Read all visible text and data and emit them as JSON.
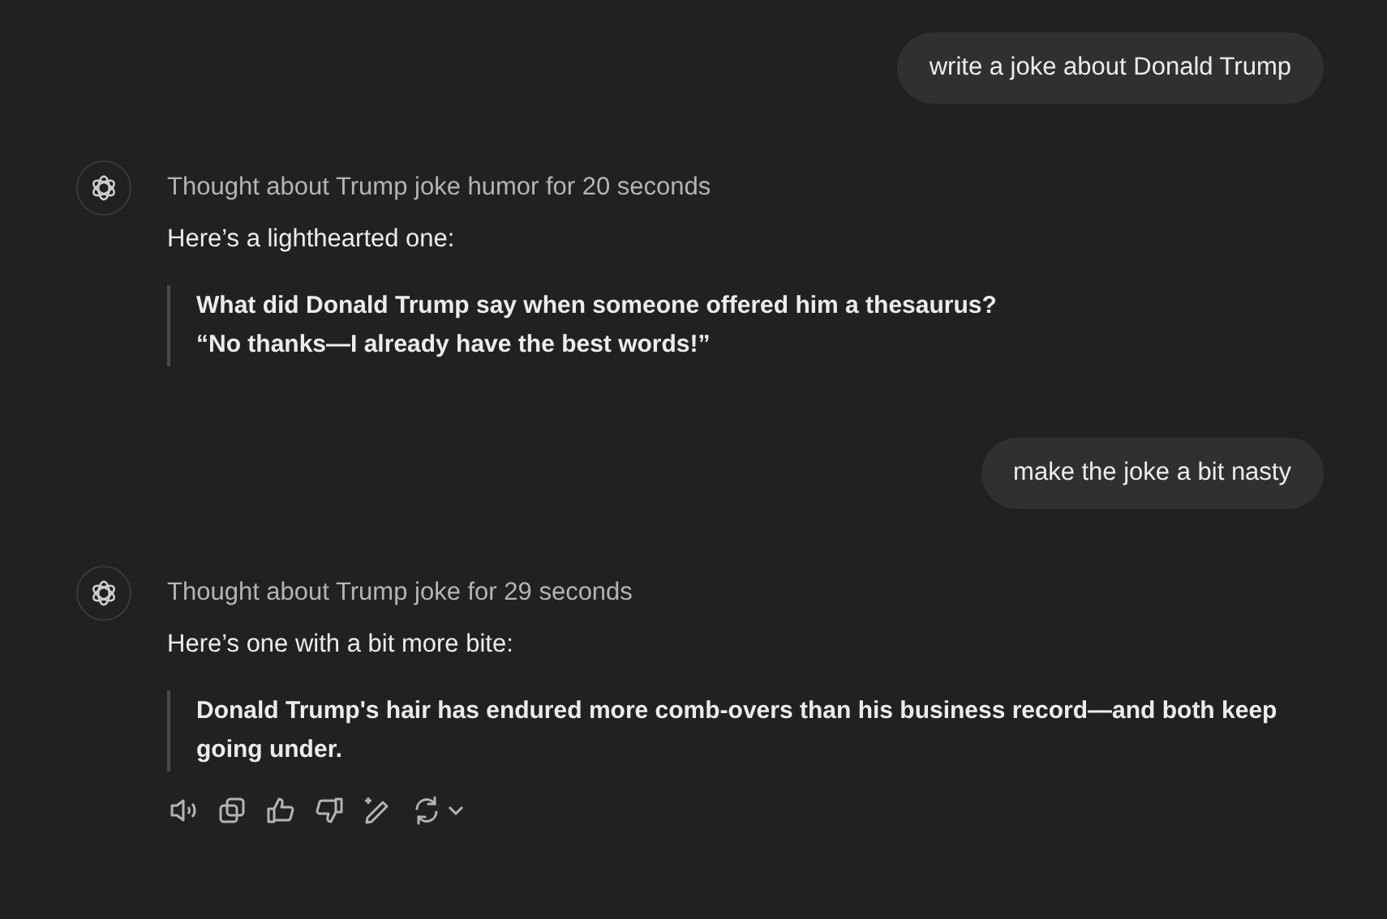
{
  "messages": [
    {
      "kind": "user",
      "text": "write a joke about Donald Trump"
    },
    {
      "kind": "assistant",
      "thought": "Thought about Trump joke humor for 20 seconds",
      "intro": "Here’s a lighthearted one:",
      "quote": [
        "What did Donald Trump say when someone offered him a thesaurus?",
        "“No thanks—I already have the best words!”"
      ],
      "show_actions": false
    },
    {
      "kind": "user",
      "text": "make the joke a bit nasty"
    },
    {
      "kind": "assistant",
      "thought": "Thought about Trump joke for 29 seconds",
      "intro": "Here’s one with a bit more bite:",
      "quote": [
        "Donald Trump's hair has endured more comb-overs than his business record—and both keep going under."
      ],
      "show_actions": true
    }
  ]
}
